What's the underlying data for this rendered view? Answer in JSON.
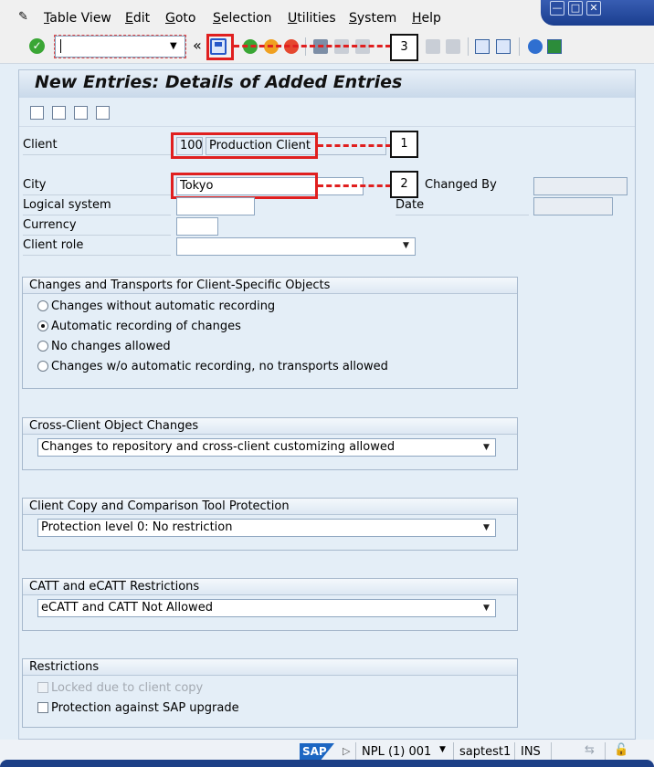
{
  "menu": {
    "items": [
      "Table View",
      "Edit",
      "Goto",
      "Selection",
      "Utilities",
      "System",
      "Help"
    ]
  },
  "toolbar": {
    "command_field_value": "",
    "callout_3": "3"
  },
  "page": {
    "title": "New Entries: Details of Added Entries"
  },
  "form": {
    "client_label": "Client",
    "client_number": "100",
    "client_name": "Production Client",
    "city_label": "City",
    "city_value": "Tokyo",
    "logical_system_label": "Logical system",
    "logical_system_value": "",
    "currency_label": "Currency",
    "currency_value": "",
    "client_role_label": "Client role",
    "client_role_value": "",
    "changed_by_label": "Changed By",
    "changed_by_value": "",
    "date_label": "Date",
    "date_value": "",
    "callout_1": "1",
    "callout_2": "2"
  },
  "changes_transports": {
    "title": "Changes and Transports for Client-Specific Objects",
    "options": [
      "Changes without automatic recording",
      "Automatic recording of changes",
      "No changes allowed",
      "Changes w/o automatic recording, no transports allowed"
    ],
    "selected_index": 1
  },
  "cross_client": {
    "title": "Cross-Client Object Changes",
    "value": "Changes to repository and cross-client customizing allowed"
  },
  "client_copy": {
    "title": "Client Copy and Comparison Tool Protection",
    "value": "Protection level 0: No restriction"
  },
  "catt": {
    "title": "CATT and eCATT Restrictions",
    "value": "eCATT and CATT Not Allowed"
  },
  "restrictions": {
    "title": "Restrictions",
    "locked_label": "Locked due to client copy",
    "protection_label": "Protection against SAP upgrade"
  },
  "status": {
    "logo": "SAP",
    "system": "NPL (1) 001",
    "server": "saptest1",
    "mode": "INS"
  }
}
